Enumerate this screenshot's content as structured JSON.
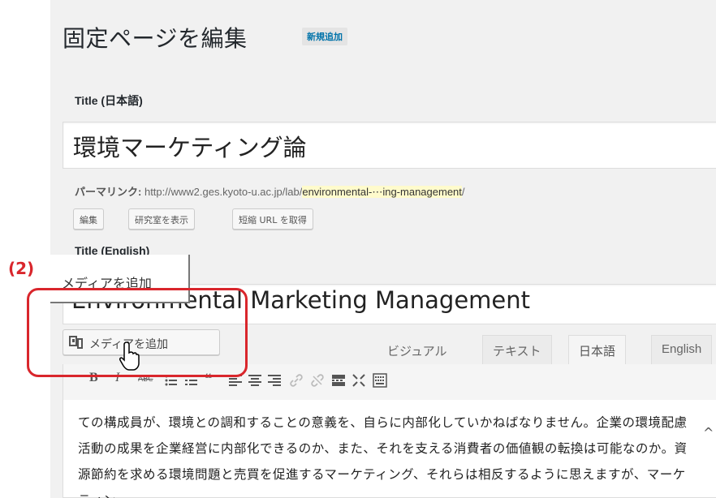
{
  "page": {
    "heading": "固定ページを編集",
    "add_new": "新規追加"
  },
  "title_ja": {
    "label": "Title (日本語)",
    "value": "環境マーケティング論"
  },
  "permalink": {
    "label": "パーマリンク:",
    "base": "http://www2.ges.kyoto-u.ac.jp/lab/",
    "slug": "environmental-⋯ing-management",
    "trail": "/",
    "buttons": [
      "編集",
      "研究室を表示",
      "短縮 URL を取得"
    ]
  },
  "title_en": {
    "label": "Title (English)",
    "value": "Environmental Marketing Management"
  },
  "callout": {
    "number": "(2)",
    "tooltip": "メディアを追加"
  },
  "media_button": {
    "label": "メディアを追加"
  },
  "editor_tabs": [
    "ビジュアル",
    "テキスト",
    "日本語",
    "English"
  ],
  "toolbar": {
    "bold": "B",
    "italic": "I",
    "strike": "ABC",
    "quote": "❝"
  },
  "editor_text": "ての構成員が、環境との調和することの意義を、自らに内部化していかねばなりません。企業の環境配慮活動の成果を企業経営に内部化できるのか、また、それを支える消費者の価値観の転換は可能なのか。資源節約を求める環境問題と売買を促進するマーケティング、それらは相反するように思えますが、マーケティン",
  "colors": {
    "callout_red": "#d9262c",
    "link_blue": "#0073aa",
    "slug_highlight": "#fffbcc"
  }
}
